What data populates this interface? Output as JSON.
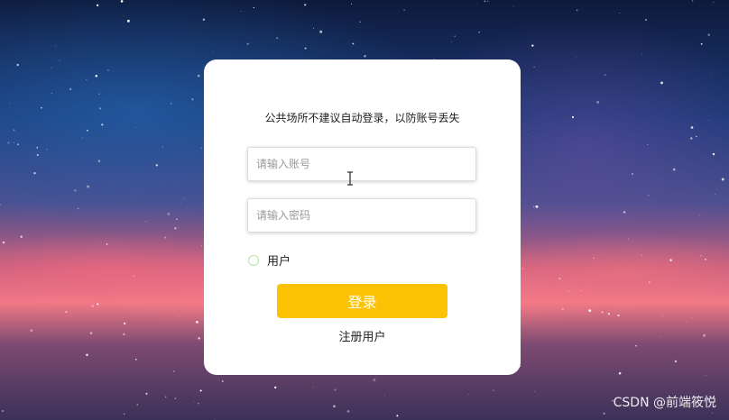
{
  "login_card": {
    "notice": "公共场所不建议自动登录，以防账号丢失",
    "account_placeholder": "请输入账号",
    "password_placeholder": "请输入密码",
    "role_option": "用户",
    "role_selected": false,
    "login_button": "登录",
    "register_link": "注册用户"
  },
  "watermark": "CSDN @前端筱悦",
  "colors": {
    "login_button": "#fcc306",
    "card_background": "#ffffff",
    "radio_border": "#b7e4a6"
  }
}
